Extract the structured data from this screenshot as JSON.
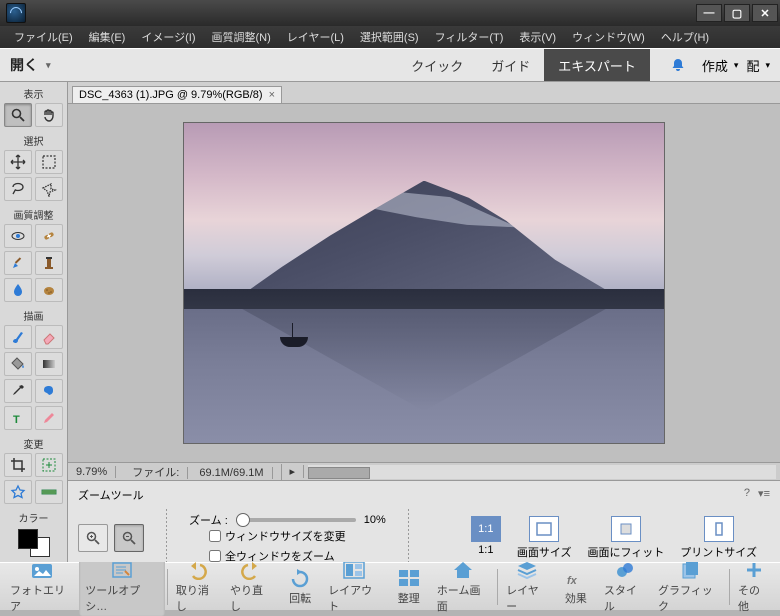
{
  "menu": {
    "file": "ファイル(E)",
    "edit": "編集(E)",
    "image": "イメージ(I)",
    "adjust": "画質調整(N)",
    "layer": "レイヤー(L)",
    "select": "選択範囲(S)",
    "filter": "フィルター(T)",
    "view": "表示(V)",
    "window": "ウィンドウ(W)",
    "help": "ヘルプ(H)"
  },
  "topbar": {
    "open": "開く",
    "quick": "クイック",
    "guide": "ガイド",
    "expert": "エキスパート",
    "create": "作成",
    "share": "配"
  },
  "tool_headers": {
    "view": "表示",
    "select": "選択",
    "adjust": "画質調整",
    "draw": "描画",
    "modify": "変更",
    "color": "カラー"
  },
  "doc": {
    "tab": "DSC_4363 (1).JPG @ 9.79%(RGB/8)",
    "zoom": "9.79%",
    "file_label": "ファイル:",
    "file_size": "69.1M/69.1M"
  },
  "options": {
    "title": "ズームツール",
    "zoom_label": "ズーム :",
    "zoom_pct": "10%",
    "chk1": "ウィンドウサイズを変更",
    "chk2": "全ウィンドウをズーム",
    "fit1": "1:1",
    "fit2": "画面サイズ",
    "fit3": "画面にフィット",
    "fit4": "プリントサイズ"
  },
  "bottom": {
    "photo": "フォトエリア",
    "toolopt": "ツールオプシ…",
    "undo": "取り消し",
    "redo": "やり直し",
    "rotate": "回転",
    "layout": "レイアウト",
    "organize": "整理",
    "home": "ホーム画面",
    "layer": "レイヤー",
    "fx": "効果",
    "style": "スタイル",
    "graphic": "グラフィック",
    "other": "その他"
  }
}
